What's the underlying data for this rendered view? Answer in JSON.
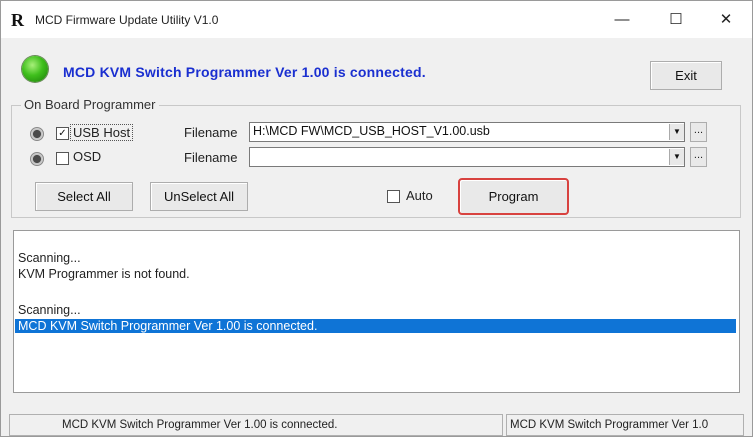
{
  "window": {
    "app_icon_letter": "R",
    "title": "MCD Firmware Update Utility V1.0",
    "minimize_glyph": "—",
    "maximize_glyph": "☐",
    "close_glyph": "✕"
  },
  "header": {
    "status_led_color": "#3fbf1c",
    "connected_message": "MCD KVM Switch Programmer Ver 1.00 is connected.",
    "exit_label": "Exit"
  },
  "programmer": {
    "group_title": "On Board Programmer",
    "rows": [
      {
        "checked": true,
        "label": "USB Host",
        "filename_label": "Filename",
        "filename_value": "H:\\MCD FW\\MCD_USB_HOST_V1.00.usb"
      },
      {
        "checked": false,
        "label": "OSD",
        "filename_label": "Filename",
        "filename_value": ""
      }
    ],
    "browse_glyph": "...",
    "dropdown_glyph": "▼",
    "check_glyph": "✓",
    "select_all_label": "Select All",
    "unselect_all_label": "UnSelect All",
    "auto_checked": false,
    "auto_label": "Auto",
    "program_label": "Program",
    "program_highlight_color": "#d8423f"
  },
  "log": {
    "lines": [
      "Scanning...",
      "KVM Programmer is not found.",
      "",
      "Scanning...",
      "MCD KVM Switch Programmer Ver 1.00 is connected."
    ],
    "selected_line_index": 4,
    "selected_color": "#0f74d6"
  },
  "statusbar": {
    "left_text": "MCD KVM Switch Programmer Ver 1.00 is connected.",
    "right_text": "MCD KVM Switch Programmer Ver 1.0"
  }
}
